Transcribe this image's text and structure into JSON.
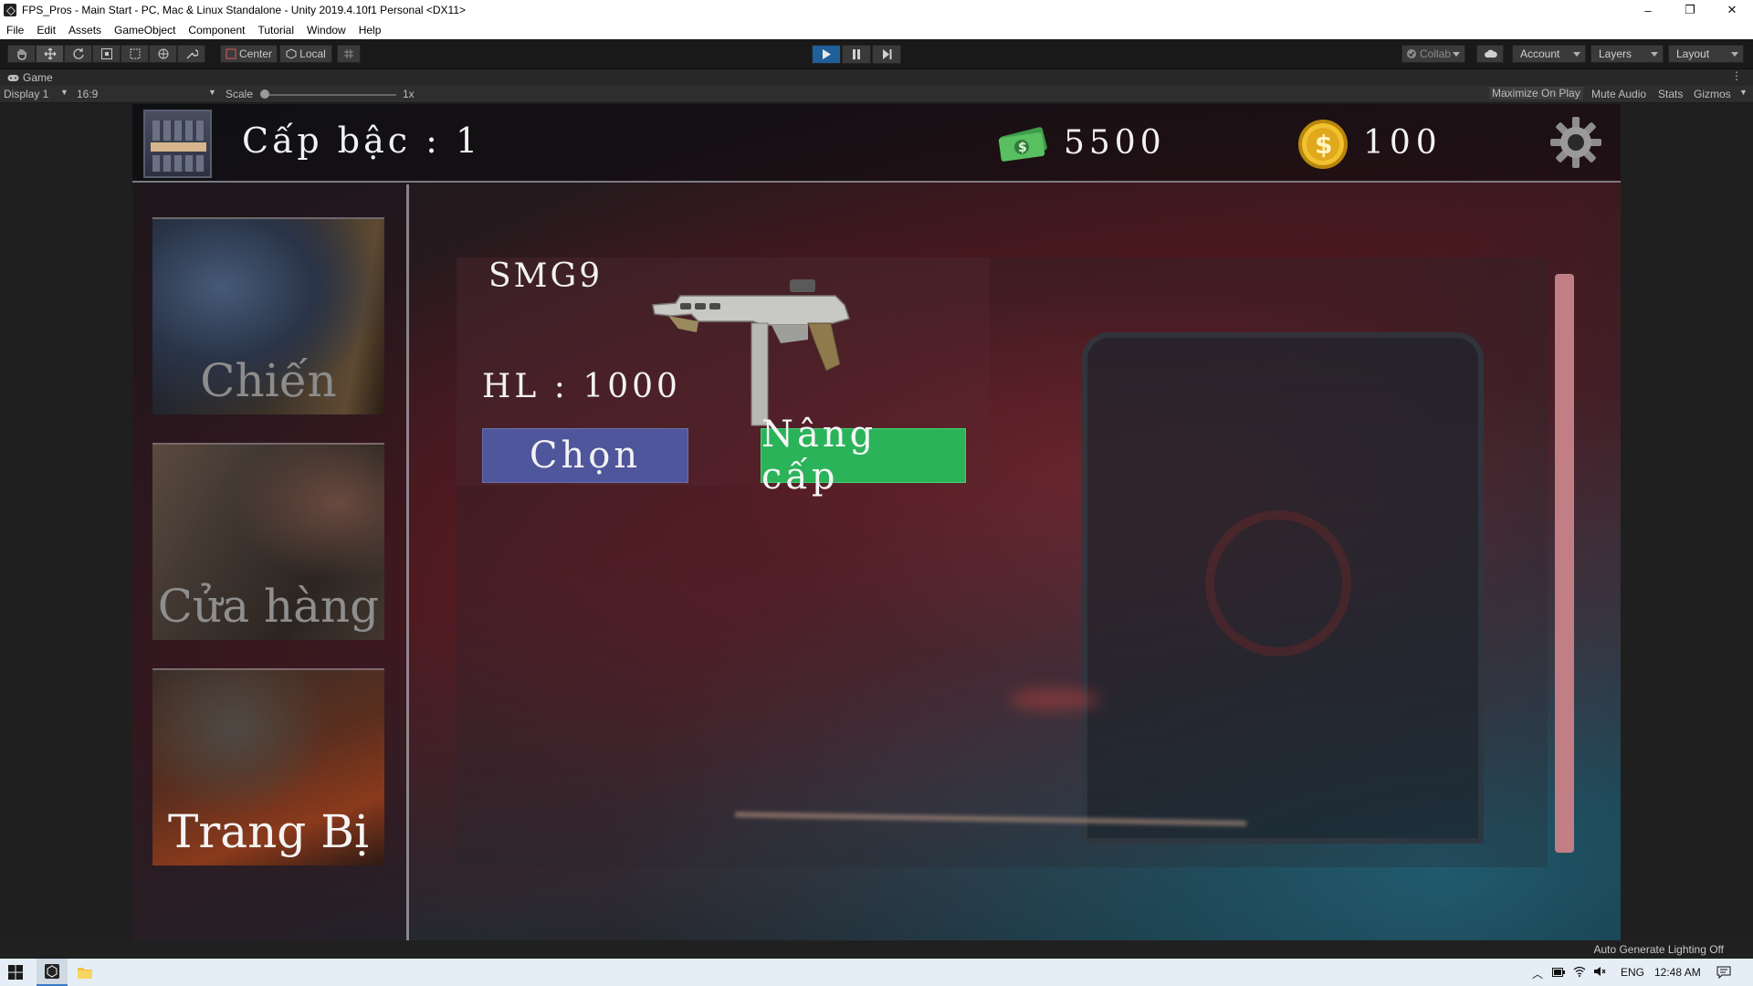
{
  "window": {
    "title": "FPS_Pros - Main Start - PC, Mac & Linux Standalone - Unity 2019.4.10f1 Personal <DX11>",
    "minimize": "–",
    "restore": "❐",
    "close": "✕"
  },
  "menu": [
    "File",
    "Edit",
    "Assets",
    "GameObject",
    "Component",
    "Tutorial",
    "Window",
    "Help"
  ],
  "toolbar": {
    "pivot_label": "Center",
    "space_label": "Local",
    "collab_label": "Collab",
    "account_label": "Account",
    "layers_label": "Layers",
    "layout_label": "Layout"
  },
  "game_view": {
    "tab_label": "Game",
    "display_label": "Display 1",
    "aspect_label": "16:9",
    "scale_label": "Scale",
    "scale_value": "1x",
    "maximize_label": "Maximize On Play",
    "mute_label": "Mute Audio",
    "stats_label": "Stats",
    "gizmos_label": "Gizmos"
  },
  "game": {
    "rank_text": "Cấp bậc : 1",
    "cash_value": "5500",
    "coin_value": "100",
    "sidebar": [
      {
        "label": "Chiến"
      },
      {
        "label": "Cửa hàng"
      },
      {
        "label": "Trang Bị"
      }
    ],
    "weapon": {
      "name": "SMG9",
      "hp": "HL : 1000",
      "select_label": "Chọn",
      "upgrade_label": "Nâng cấp"
    }
  },
  "statusbar": {
    "text": "Auto Generate Lighting Off"
  },
  "taskbar": {
    "language": "ENG",
    "time": "12:48 AM"
  },
  "colors": {
    "select_button": "#4f569b",
    "upgrade_button": "#2bb35a",
    "scrollbar": "#c27e85",
    "play_active": "#1f5f9a"
  }
}
